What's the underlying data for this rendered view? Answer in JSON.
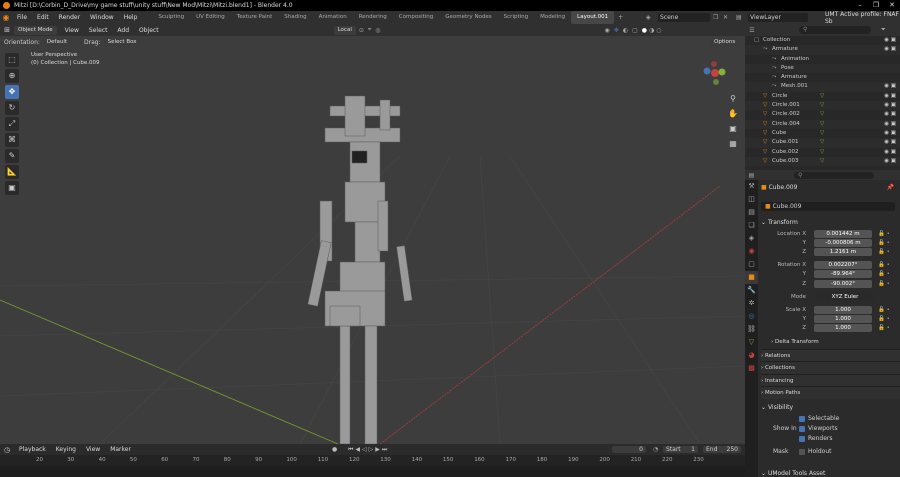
{
  "window": {
    "title": "Mitzi [D:\\Corbin_D_Drive\\my game stuff\\unity stuff\\New Mod\\Mitzi\\Mitzi.blend1] - Blender 4.0"
  },
  "menu": [
    "File",
    "Edit",
    "Render",
    "Window",
    "Help"
  ],
  "workspaces": [
    "Sculpting",
    "UV Editing",
    "Texture Paint",
    "Shading",
    "Animation",
    "Rendering",
    "Compositing",
    "Geometry Nodes",
    "Scripting",
    "Modeling",
    "Layout.001"
  ],
  "topright": {
    "scene": "Scene",
    "viewlayer": "ViewLayer",
    "profile": "UMT Active profile: FNAF Sb"
  },
  "viewport_header": {
    "mode": "Object Mode",
    "view": "View",
    "select": "Select",
    "add": "Add",
    "object": "Object",
    "transform": "Local",
    "options": "Options"
  },
  "viewport_header2": {
    "orientation_label": "Orientation:",
    "orientation": "Default",
    "drag_label": "Drag:",
    "drag": "Select Box"
  },
  "viewport": {
    "perspective": "User Perspective",
    "collection": "(0) Collection | Cube.009"
  },
  "timeline": {
    "menu": [
      "Playback",
      "Keying",
      "View",
      "Marker"
    ],
    "current_frame": "0",
    "start_label": "Start",
    "start": "1",
    "end_label": "End",
    "end": "250",
    "ticks": [
      "20",
      "30",
      "40",
      "50",
      "60",
      "70",
      "80",
      "90",
      "100",
      "110",
      "120",
      "130",
      "140",
      "150",
      "160",
      "170",
      "180",
      "190",
      "200",
      "210",
      "220",
      "230"
    ]
  },
  "outliner": {
    "rows": [
      {
        "name": "Collection",
        "indent": 0
      },
      {
        "name": "Armature",
        "indent": 1
      },
      {
        "name": "Animation",
        "indent": 2
      },
      {
        "name": "Pose",
        "indent": 2
      },
      {
        "name": "Armature",
        "indent": 2
      },
      {
        "name": "Mesh.001",
        "indent": 2
      },
      {
        "name": "Circle",
        "indent": 1
      },
      {
        "name": "Circle.001",
        "indent": 1
      },
      {
        "name": "Circle.002",
        "indent": 1
      },
      {
        "name": "Circle.004",
        "indent": 1
      },
      {
        "name": "Cube",
        "indent": 1
      },
      {
        "name": "Cube.001",
        "indent": 1
      },
      {
        "name": "Cube.002",
        "indent": 1
      },
      {
        "name": "Cube.003",
        "indent": 1
      }
    ]
  },
  "properties": {
    "object_name": "Cube.009",
    "object_field": "Cube.009",
    "transform_label": "Transform",
    "location": {
      "label": "Location X",
      "x": "0.001442 m",
      "y": "-0.000806 m",
      "z": "1.2161 m"
    },
    "rotation": {
      "label": "Rotation X",
      "x": "0.002207°",
      "y": "-89.964°",
      "z": "-90.002°"
    },
    "mode": {
      "label": "Mode",
      "value": "XYZ Euler"
    },
    "scale": {
      "label": "Scale X",
      "x": "1.000",
      "y": "1.000",
      "z": "1.000"
    },
    "axis_y": "Y",
    "axis_z": "Z",
    "sections": [
      "Delta Transform",
      "Relations",
      "Collections",
      "Instancing",
      "Motion Paths"
    ],
    "visibility": {
      "label": "Visibility",
      "selectable": "Selectable",
      "show_in": "Show In",
      "viewports": "Viewports",
      "renders": "Renders",
      "mask": "Mask",
      "holdout": "Holdout"
    },
    "umodel": "UModel Tools Asset"
  },
  "colors": {
    "accent": "#4772b3",
    "orange": "#e8891a",
    "x_axis": "#c8403e",
    "y_axis": "#7fb33c"
  }
}
